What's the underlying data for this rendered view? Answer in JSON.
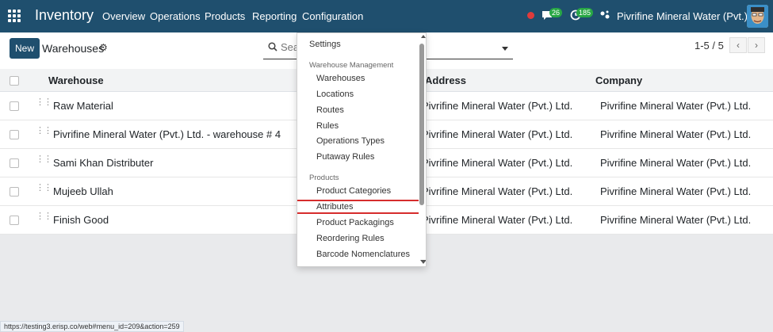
{
  "navbar": {
    "app_title": "Inventory",
    "menus": [
      "Overview",
      "Operations",
      "Products",
      "Reporting",
      "Configuration"
    ],
    "messages_count": "26",
    "activities_count": "185",
    "company": "Pivrifine Mineral Water (Pvt.) Ltd.",
    "brand_color": "#1f4f6e"
  },
  "control_panel": {
    "new_label": "New",
    "title": "Warehouses",
    "search_placeholder": "Search...",
    "pager_text": "1-5 / 5",
    "prev_icon": "chevron-left-icon",
    "next_icon": "chevron-right-icon"
  },
  "table": {
    "columns": [
      "Warehouse",
      "Address",
      "Company"
    ],
    "rows": [
      {
        "warehouse": "Raw Material",
        "address": "Pivrifine Mineral Water (Pvt.) Ltd.",
        "company": "Pivrifine Mineral Water (Pvt.) Ltd."
      },
      {
        "warehouse": "Pivrifine Mineral Water (Pvt.) Ltd. - warehouse # 4",
        "address": "Pivrifine Mineral Water (Pvt.) Ltd.",
        "company": "Pivrifine Mineral Water (Pvt.) Ltd."
      },
      {
        "warehouse": "Sami Khan Distributer",
        "address": "Pivrifine Mineral Water (Pvt.) Ltd.",
        "company": "Pivrifine Mineral Water (Pvt.) Ltd."
      },
      {
        "warehouse": "Mujeeb Ullah",
        "address": "Pivrifine Mineral Water (Pvt.) Ltd.",
        "company": "Pivrifine Mineral Water (Pvt.) Ltd."
      },
      {
        "warehouse": "Finish Good",
        "address": "Pivrifine Mineral Water (Pvt.) Ltd.",
        "company": "Pivrifine Mineral Water (Pvt.) Ltd."
      }
    ]
  },
  "dropdown": {
    "settings": "Settings",
    "section_warehouse": "Warehouse Management",
    "warehouse_items": [
      "Warehouses",
      "Locations",
      "Routes",
      "Rules",
      "Operations Types",
      "Putaway Rules"
    ],
    "section_products": "Products",
    "product_items": [
      "Product Categories",
      "Attributes",
      "Product Packagings",
      "Reordering Rules",
      "Barcode Nomenclatures"
    ],
    "highlighted_item": "Attributes",
    "highlight_color": "#d62c2c"
  },
  "status_url": "https://testing3.erisp.co/web#menu_id=209&action=259"
}
